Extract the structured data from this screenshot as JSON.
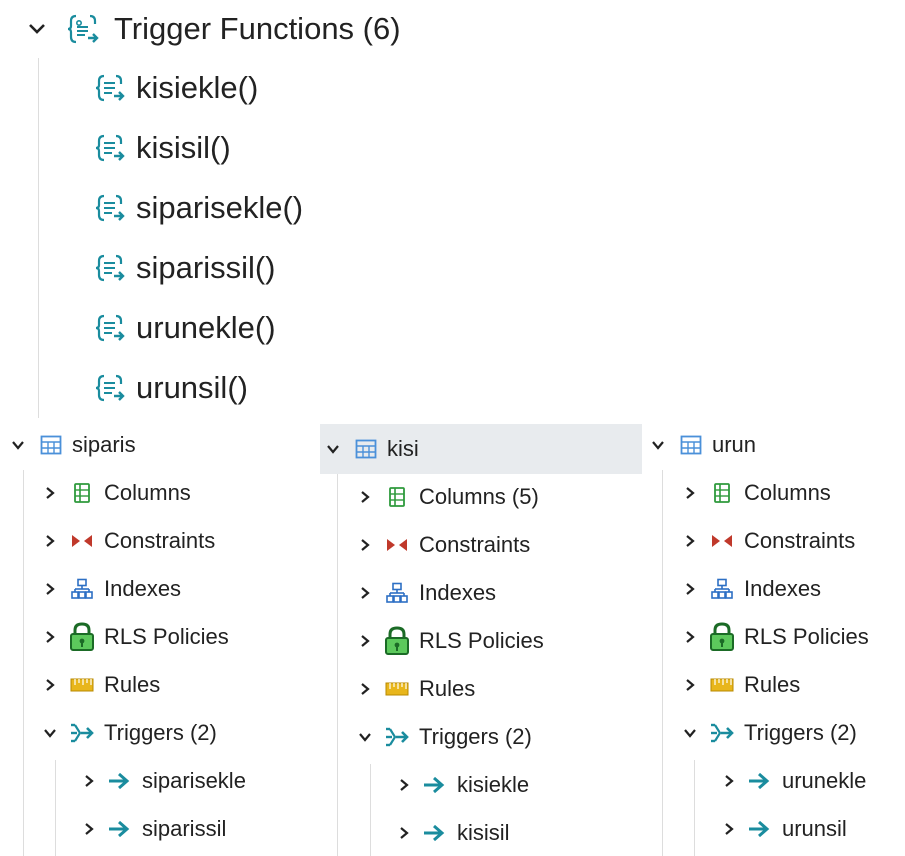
{
  "trigger_functions": {
    "header": "Trigger Functions (6)",
    "items": [
      "kisiekle()",
      "kisisil()",
      "siparisekle()",
      "siparissil()",
      "urunekle()",
      "urunsil()"
    ]
  },
  "tables": [
    {
      "name": "siparis",
      "children": [
        "Columns",
        "Constraints",
        "Indexes",
        "RLS Policies",
        "Rules",
        "Triggers (2)"
      ],
      "triggers": [
        "siparisekle",
        "siparissil"
      ]
    },
    {
      "name": "kisi",
      "children": [
        "Columns (5)",
        "Constraints",
        "Indexes",
        "RLS Policies",
        "Rules",
        "Triggers (2)"
      ],
      "triggers": [
        "kisiekle",
        "kisisil"
      ]
    },
    {
      "name": "urun",
      "children": [
        "Columns",
        "Constraints",
        "Indexes",
        "RLS Policies",
        "Rules",
        "Triggers (2)"
      ],
      "triggers": [
        "urunekle",
        "urunsil"
      ]
    }
  ],
  "colors": {
    "teal": "#1a8c9e",
    "table_blue": "#4a90d9",
    "constraint_red": "#c0392b",
    "index_blue": "#2d6fc4",
    "rls_green": "#2e9a3c",
    "rules_yellow": "#e8b61c",
    "selected_bg": "#e8ebee"
  },
  "icons": {
    "trigger_function": "trigger-function-icon",
    "table": "table-icon",
    "columns": "columns-icon",
    "constraints": "constraints-icon",
    "indexes": "indexes-icon",
    "rls": "lock-icon",
    "rules": "rules-icon",
    "triggers": "triggers-icon",
    "trigger": "arrow-right-icon"
  }
}
